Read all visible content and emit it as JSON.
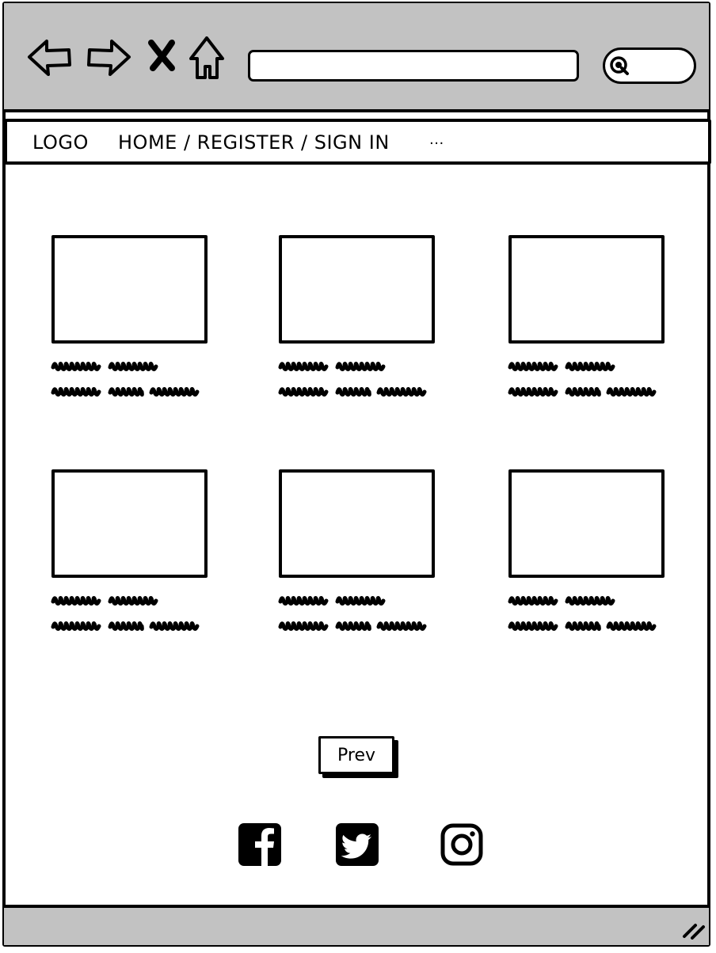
{
  "site_nav": {
    "logo": "LOGO",
    "links": "HOME / REGISTER / SIGN IN",
    "more": "..."
  },
  "browser": {
    "icons": [
      "back-arrow-icon",
      "forward-arrow-icon",
      "close-icon",
      "home-icon",
      "search-icon"
    ],
    "address_value": ""
  },
  "cards": [
    {
      "image": "placeholder",
      "text_lines": 2
    },
    {
      "image": "placeholder",
      "text_lines": 2
    },
    {
      "image": "placeholder",
      "text_lines": 2
    },
    {
      "image": "placeholder",
      "text_lines": 2
    },
    {
      "image": "placeholder",
      "text_lines": 2
    },
    {
      "image": "placeholder",
      "text_lines": 2
    }
  ],
  "pagination": {
    "prev_label": "Prev"
  },
  "social_icons": [
    "facebook-icon",
    "twitter-icon",
    "instagram-icon"
  ],
  "colors": {
    "chrome_gray": "#c2c2c2",
    "ink": "#000000",
    "paper": "#ffffff"
  }
}
